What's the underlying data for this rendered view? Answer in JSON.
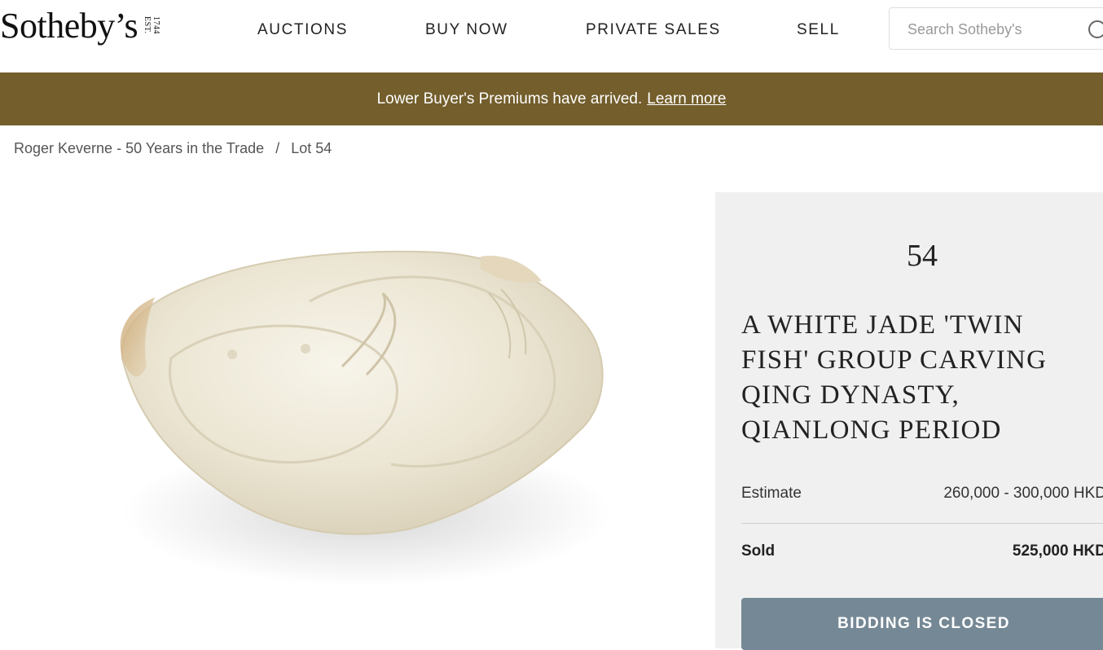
{
  "header": {
    "logo_text": "Sotheby’s",
    "logo_est": "EST.",
    "logo_year": "1744",
    "nav": [
      "AUCTIONS",
      "BUY NOW",
      "PRIVATE SALES",
      "SELL"
    ],
    "search_placeholder": "Search Sotheby's"
  },
  "banner": {
    "message": "Lower Buyer's Premiums have arrived.",
    "link": "Learn more",
    "color": "#735e2c"
  },
  "breadcrumb": {
    "parent": "Roger Keverne - 50 Years in the Trade",
    "separator": "/",
    "current": "Lot 54"
  },
  "lot": {
    "number": "54",
    "title": "A WHITE JADE 'TWIN FISH' GROUP CARVING QING DYNASTY, QIANLONG PERIOD",
    "estimate_label": "Estimate",
    "estimate_value": "260,000 - 300,000 HKD",
    "sold_label": "Sold",
    "sold_value": "525,000 HKD",
    "button_label": "BIDDING IS CLOSED",
    "button_color": "#758895"
  }
}
